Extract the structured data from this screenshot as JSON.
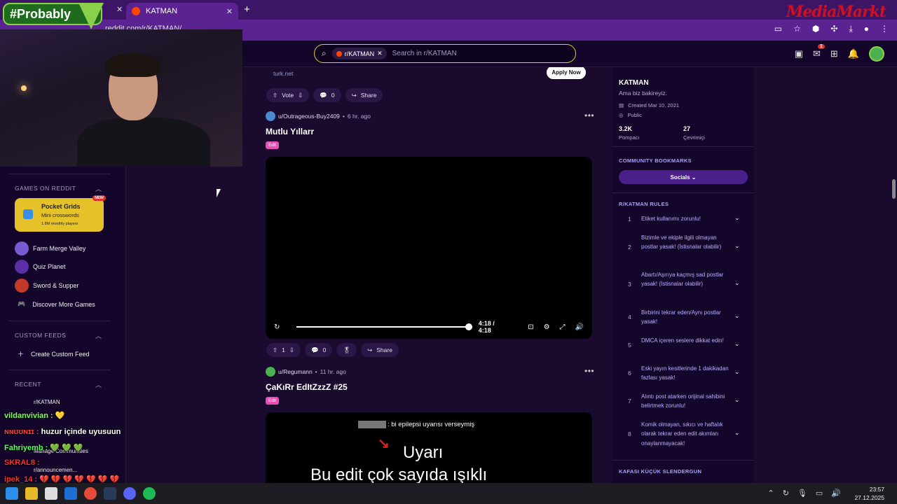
{
  "browser": {
    "tab_title": "KATMAN",
    "address": "reddit.com/r/KATMAN/",
    "overlay_tag": "#Probably",
    "brand_logo": "MediaMarkt"
  },
  "header": {
    "search_chip": "r/KATMAN",
    "search_placeholder": "Search in r/KATMAN",
    "notif_count": "1"
  },
  "left_sidebar": {
    "games_header": "GAMES ON REDDIT",
    "featured_game": {
      "title": "Pocket Grids",
      "subtitle": "Mini crosswords",
      "players": "1.8M monthly players",
      "badge": "NEW"
    },
    "games": [
      {
        "label": "Farm Merge Valley",
        "color": "#7a5ad0"
      },
      {
        "label": "Quiz Planet",
        "color": "#5b2ea8"
      },
      {
        "label": "Sword & Supper",
        "color": "#c0392b"
      }
    ],
    "discover": "Discover More Games",
    "custom_header": "CUSTOM FEEDS",
    "create_feed": "Create Custom Feed",
    "recent_header": "RECENT",
    "recent_item": "r/KATMAN",
    "manage": "Manage Communities",
    "announce": "r/announcemen..."
  },
  "chat": [
    {
      "user": "vildanvivian :",
      "msg": "💛",
      "color": "#7dff5a"
    },
    {
      "user": "ɴɴʊʊɴɪɪ :",
      "msg": "huzur içinde uyusuun",
      "color": "#ff4040"
    },
    {
      "user": "Fahriyemb :",
      "msg": "💚  💚  💚",
      "color": "#5aff5a"
    },
    {
      "user": "SKRAL8 :",
      "msg": "",
      "color": "#ff3030"
    },
    {
      "user": "ipek_14 :",
      "msg": "💔 💔 💔 💔 💔 💔 💔",
      "color": "#ff3030"
    }
  ],
  "feed": {
    "ad_link": "turk.net",
    "apply_label": "Apply Now",
    "ad_actions": {
      "vote": "Vote",
      "comments": "0",
      "share": "Share"
    },
    "posts": [
      {
        "user": "u/Outrageous-Buy2409",
        "time": "6 hr. ago",
        "title": "Mutlu Yıllarr",
        "flair": "Edit",
        "video_time": "4:18 / 4:18",
        "votes": "1",
        "comments": "0",
        "share": "Share"
      },
      {
        "user": "u/Regumann",
        "time": "11 hr. ago",
        "title": "ÇaKıRr EdItZzzZ #25",
        "flair": "Edit",
        "thumb_line1": ": bi epilepsi uyarısı verseymiş",
        "thumb_uyari": "Uyarı",
        "thumb_line2": "Bu edit çok sayıda ışıklı"
      }
    ]
  },
  "right_sidebar": {
    "name": "KATMAN",
    "description": "Ama biz bakireyiz.",
    "created": "Created Mar 10, 2021",
    "visibility": "Public",
    "members": "3.2K",
    "members_label": "Pompacı",
    "online": "27",
    "online_label": "Çevrimiçi",
    "bookmarks_header": "COMMUNITY BOOKMARKS",
    "socials": "Socials",
    "rules_header": "R/KATMAN RULES",
    "rules": [
      {
        "n": "1",
        "text": "Etiket kullanımı zorunlu!"
      },
      {
        "n": "2",
        "text": "Bizimle ve ekiple ilgili olmayan postlar yasak! (İstisnalar olabilir)"
      },
      {
        "n": "3",
        "text": "Abartı/Aşırıya kaçmış sad postlar yasak! (İstisnalar olabilir)"
      },
      {
        "n": "4",
        "text": "Birbirini tekrar eden/Aynı postlar yasak!"
      },
      {
        "n": "5",
        "text": "DMCA içeren seslere dikkat edin!"
      },
      {
        "n": "6",
        "text": "Eski yayın kesitlerinde 1 dakikadan fazlası yasak!"
      },
      {
        "n": "7",
        "text": "Alıntı post atarken orijinal sahibini belirtmek zorunlu!"
      },
      {
        "n": "8",
        "text": "Komik olmayan, sıkıcı ve haftalık olarak tekrar eden edit akımları onaylanmayacak!"
      }
    ],
    "flair_header": "KAFASI KÜÇÜK SLENDERGUN"
  },
  "taskbar": {
    "time": "23:57",
    "date": "27.12.2025"
  }
}
